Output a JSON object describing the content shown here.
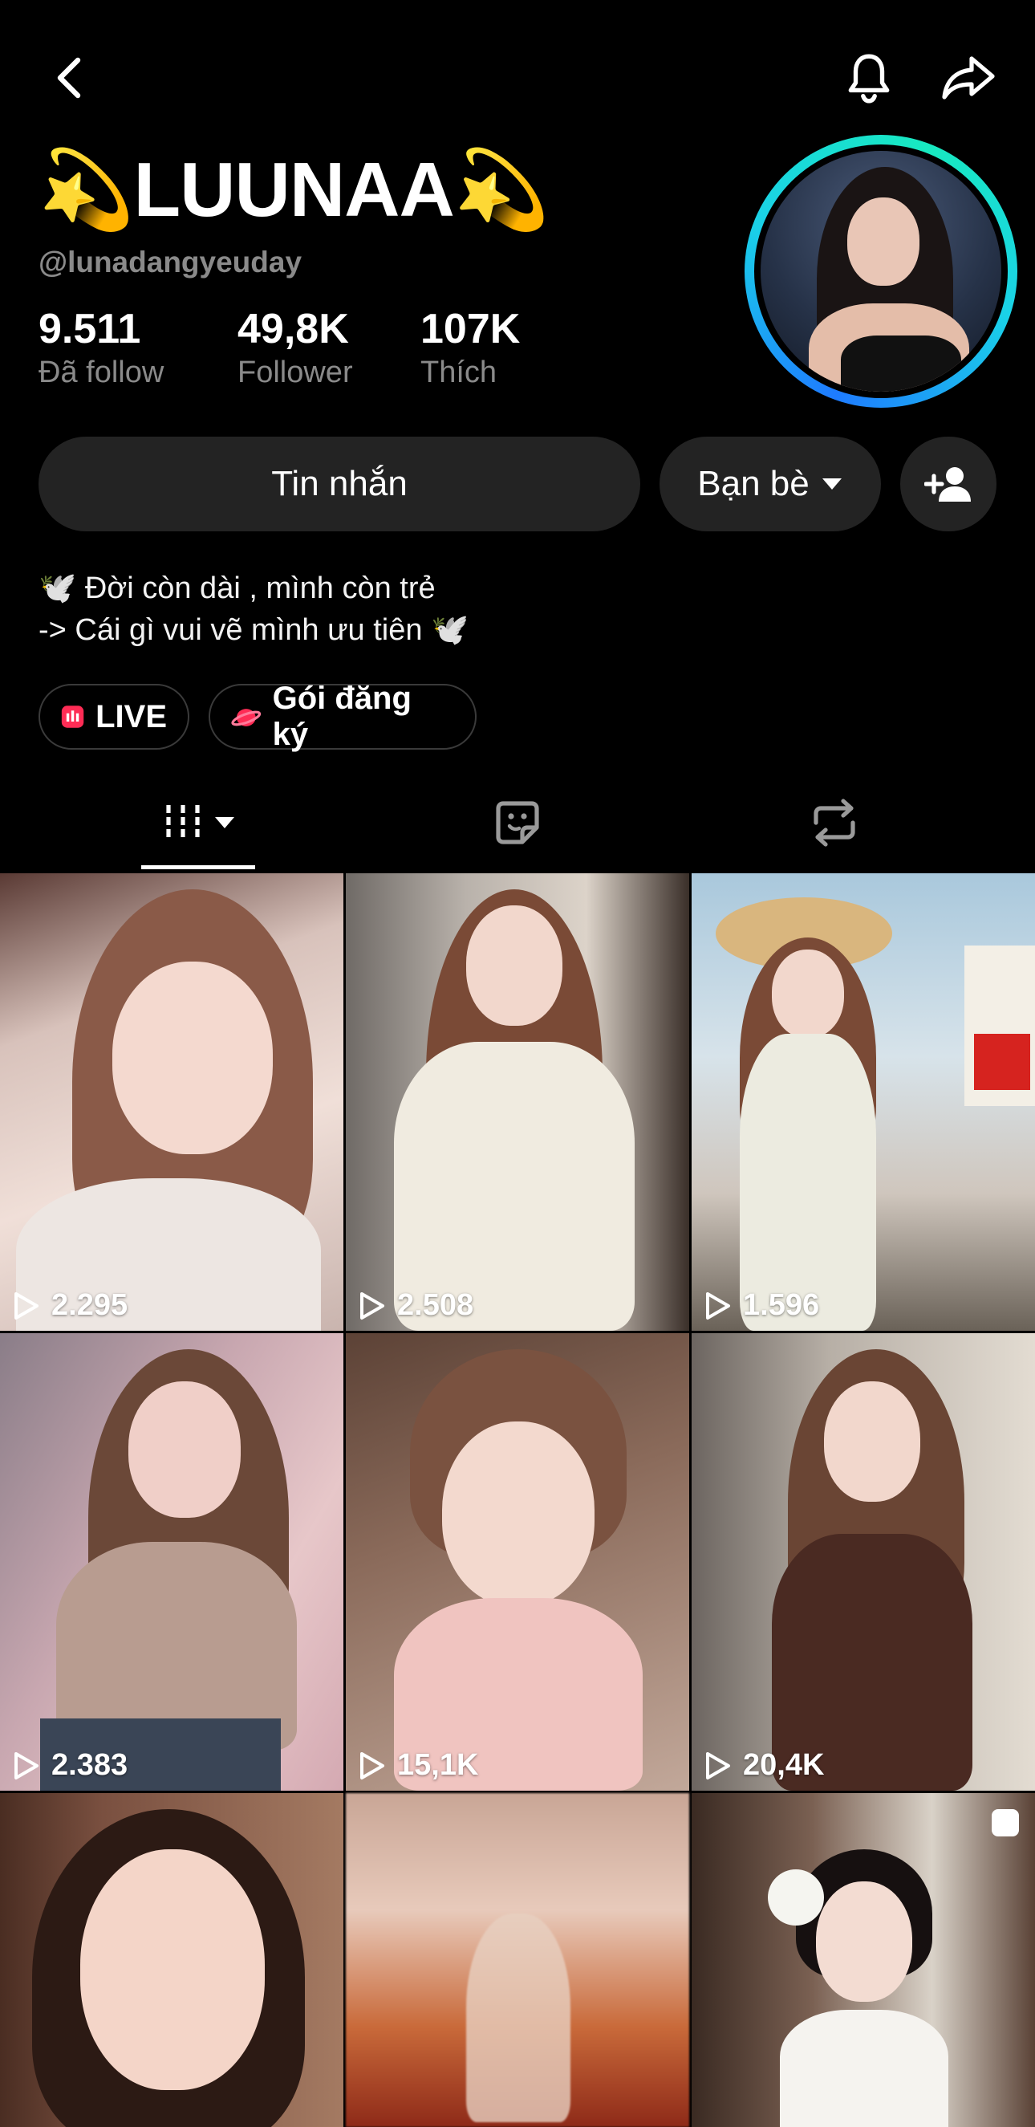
{
  "profile": {
    "display_name": "💫LUUNAA💫",
    "handle": "@lunadangyeuday",
    "stats": [
      {
        "value": "9.511",
        "label": "Đã follow"
      },
      {
        "value": "49,8K",
        "label": "Follower"
      },
      {
        "value": "107K",
        "label": "Thích"
      }
    ]
  },
  "actions": {
    "message_label": "Tin nhắn",
    "friends_label": "Bạn bè"
  },
  "bio": {
    "line1": "🕊️ Đời còn dài , mình còn trẻ",
    "line2": "-> Cái gì vui vẽ mình ưu tiên 🕊️"
  },
  "chips": {
    "live_label": "LIVE",
    "subscription_label": "Gói đăng ký"
  },
  "icons": {
    "back": "chevron-left-icon",
    "notifications": "bell-icon",
    "share": "share-arrow-icon",
    "add_friend": "add-person-icon",
    "tab_videos": "grid-bars-icon",
    "tab_favorites": "sticker-icon",
    "tab_reposts": "repost-icon"
  },
  "colors": {
    "background": "#000000",
    "button_bg": "#232323",
    "secondary_text": "#8a8a8a",
    "avatar_ring_blue": "#1e7bff",
    "avatar_ring_teal": "#18e9c0",
    "live_red": "#fe2c55"
  },
  "videos": [
    {
      "views": "2.295"
    },
    {
      "views": "2.508"
    },
    {
      "views": "1.596"
    },
    {
      "views": "2.383"
    },
    {
      "views": "15,1K"
    },
    {
      "views": "20,4K"
    },
    {
      "views": ""
    },
    {
      "views": ""
    },
    {
      "views": ""
    }
  ]
}
